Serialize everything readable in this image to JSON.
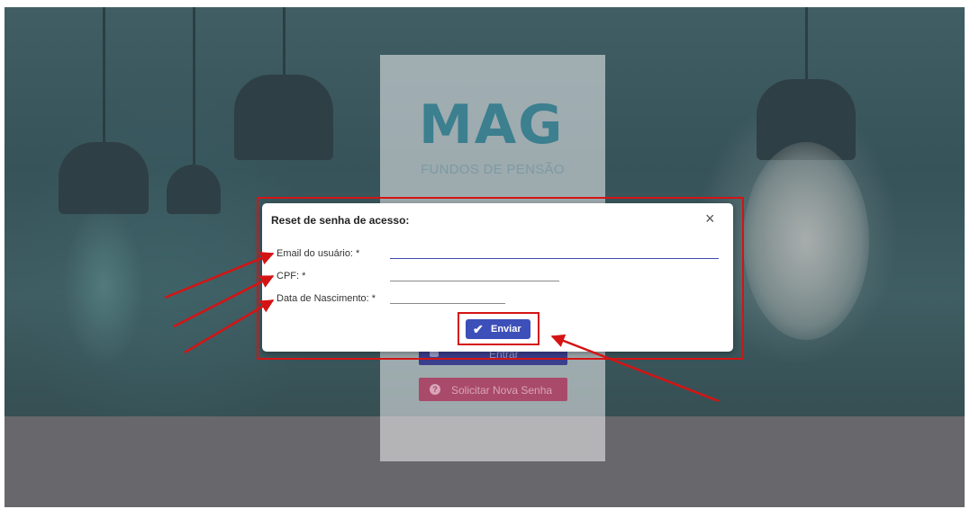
{
  "background_login": {
    "logo": "MAG",
    "logo_subtitle": "FUNDOS DE PENSÃO",
    "enter_button": "Entrar",
    "request_password_button": "Solicitar Nova Senha"
  },
  "dialog": {
    "title": "Reset de senha de acesso:",
    "close_icon": "×",
    "fields": {
      "email": {
        "label": "Email do usuário: *",
        "value": ""
      },
      "cpf": {
        "label": "CPF: *",
        "value": ""
      },
      "birthdate": {
        "label": "Data de Nascimento: *",
        "value": ""
      }
    },
    "submit_label": "Enviar",
    "submit_icon": "check-icon"
  },
  "colors": {
    "submit_button": "#3d4fb8",
    "annotation": "#d41414",
    "logo": "#3c7f8f"
  }
}
